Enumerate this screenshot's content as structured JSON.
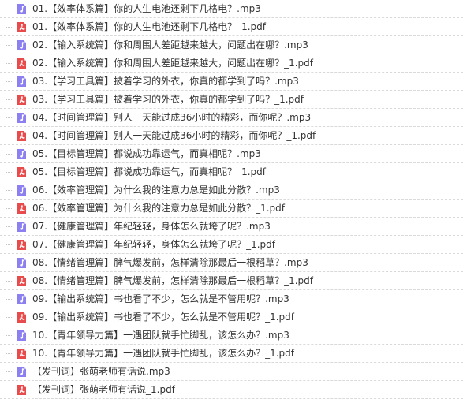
{
  "colors": {
    "mp3_icon": "#8c7ff0",
    "pdf_icon": "#e84b4b",
    "text": "#333333",
    "row_border": "#d9d9d9"
  },
  "files": [
    {
      "type": "mp3",
      "icon": "music-file-icon",
      "name": "01.【效率体系篇】你的人生电池还剩下几格电？.mp3"
    },
    {
      "type": "pdf",
      "icon": "pdf-file-icon",
      "name": "01.【效率体系篇】你的人生电池还剩下几格电？_1.pdf"
    },
    {
      "type": "mp3",
      "icon": "music-file-icon",
      "name": "02.【输入系统篇】你和周围人差距越来越大，问题出在哪？.mp3"
    },
    {
      "type": "pdf",
      "icon": "pdf-file-icon",
      "name": "02.【输入系统篇】你和周围人差距越来越大，问题出在哪？_1.pdf"
    },
    {
      "type": "mp3",
      "icon": "music-file-icon",
      "name": "03.【学习工具篇】披着学习的外衣，你真的都学到了吗？.mp3"
    },
    {
      "type": "pdf",
      "icon": "pdf-file-icon",
      "name": "03.【学习工具篇】披着学习的外衣，你真的都学到了吗？_1.pdf"
    },
    {
      "type": "mp3",
      "icon": "music-file-icon",
      "name": "04.【时间管理篇】别人一天能过成36小时的精彩，而你呢？.mp3"
    },
    {
      "type": "pdf",
      "icon": "pdf-file-icon",
      "name": "04.【时间管理篇】别人一天能过成36小时的精彩，而你呢？_1.pdf"
    },
    {
      "type": "mp3",
      "icon": "music-file-icon",
      "name": "05.【目标管理篇】都说成功靠运气，而真相呢？.mp3"
    },
    {
      "type": "pdf",
      "icon": "pdf-file-icon",
      "name": "05.【目标管理篇】都说成功靠运气，而真相呢？_1.pdf"
    },
    {
      "type": "mp3",
      "icon": "music-file-icon",
      "name": "06.【效率管理篇】为什么我的注意力总是如此分散？.mp3"
    },
    {
      "type": "pdf",
      "icon": "pdf-file-icon",
      "name": "06.【效率管理篇】为什么我的注意力总是如此分散？_1.pdf"
    },
    {
      "type": "mp3",
      "icon": "music-file-icon",
      "name": "07.【健康管理篇】年纪轻轻，身体怎么就垮了呢？.mp3"
    },
    {
      "type": "pdf",
      "icon": "pdf-file-icon",
      "name": "07.【健康管理篇】年纪轻轻，身体怎么就垮了呢？_1.pdf"
    },
    {
      "type": "mp3",
      "icon": "music-file-icon",
      "name": "08.【情绪管理篇】脾气爆发前，怎样清除那最后一根稻草？.mp3"
    },
    {
      "type": "pdf",
      "icon": "pdf-file-icon",
      "name": "08.【情绪管理篇】脾气爆发前，怎样清除那最后一根稻草？_1.pdf"
    },
    {
      "type": "mp3",
      "icon": "music-file-icon",
      "name": "09.【输出系统篇】书也看了不少，怎么就是不管用呢？.mp3"
    },
    {
      "type": "pdf",
      "icon": "pdf-file-icon",
      "name": "09.【输出系统篇】书也看了不少，怎么就是不管用呢？_1.pdf"
    },
    {
      "type": "mp3",
      "icon": "music-file-icon",
      "name": "10.【青年领导力篇】一遇团队就手忙脚乱，该怎么办？.mp3"
    },
    {
      "type": "pdf",
      "icon": "pdf-file-icon",
      "name": "10.【青年领导力篇】一遇团队就手忙脚乱，该怎么办？_1.pdf"
    },
    {
      "type": "mp3",
      "icon": "music-file-icon",
      "name": "【发刊词】张萌老师有话说.mp3"
    },
    {
      "type": "pdf",
      "icon": "pdf-file-icon",
      "name": "【发刊词】张萌老师有话说_1.pdf"
    }
  ]
}
